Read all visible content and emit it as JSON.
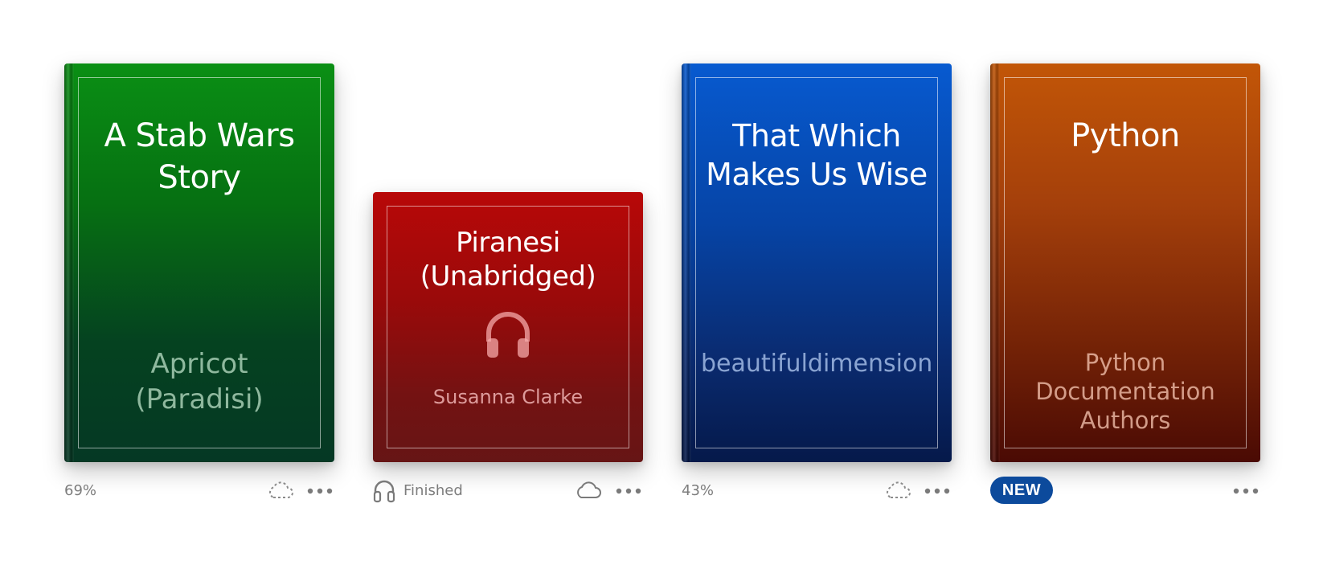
{
  "books": [
    {
      "title": "A Stab Wars Story",
      "author": "Apricot (Paradisi)",
      "progress": "69%",
      "cloud": "cloud-dashed-icon",
      "color": "#067012"
    },
    {
      "title": "Piranesi (Unabridged)",
      "author": "Susanna Clarke",
      "status": "Finished",
      "type_icon": "headphones-icon",
      "cloud": "cloud-icon",
      "color": "#9a0a0a"
    },
    {
      "title": "That Which Makes Us Wise",
      "author": "beautifuldimension",
      "progress": "43%",
      "cloud": "cloud-dashed-icon",
      "color": "#0644a6"
    },
    {
      "title": "Python",
      "author": "Python Documentation Authors",
      "badge": "NEW",
      "color": "#a5400b",
      "badge_color": "#0c4a9c"
    }
  ]
}
